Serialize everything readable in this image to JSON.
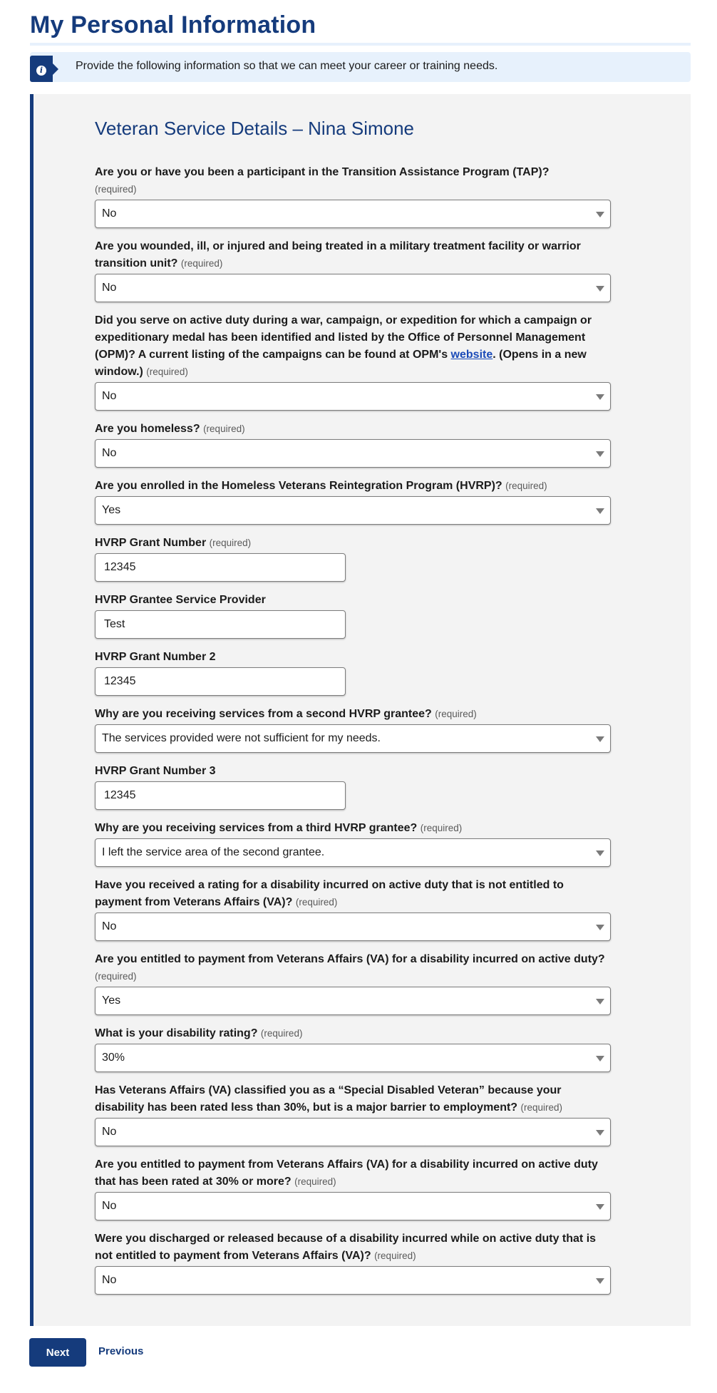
{
  "page": {
    "title": "My Personal Information",
    "info_banner": "Provide the following information so that we can meet your career or training needs.",
    "info_icon": "info-icon"
  },
  "panel": {
    "section_title": "Veteran Service Details – Nina Simone",
    "required_text": "(required)",
    "fields": [
      {
        "type": "select",
        "label": "Are you or have you been a participant in the Transition Assistance Program (TAP)?",
        "required": true,
        "value": "No"
      },
      {
        "type": "select",
        "label": "Are you wounded, ill, or injured and being treated in a military treatment facility or warrior transition unit?",
        "required": true,
        "value": "No"
      },
      {
        "type": "select",
        "label_before_link": "Did you serve on active duty during a war, campaign, or expedition for which a campaign or expeditionary medal has been identified and listed by the Office of Personnel Management (OPM)? A current listing of the campaigns can be found at OPM's ",
        "link_text": "website",
        "label_after_link": ". (Opens in a new window.)",
        "required": true,
        "value": "No"
      },
      {
        "type": "select",
        "label": "Are you homeless?",
        "required": true,
        "value": "No"
      },
      {
        "type": "select",
        "label": "Are you enrolled in the Homeless Veterans Reintegration Program (HVRP)?",
        "required": true,
        "value": "Yes"
      },
      {
        "type": "input",
        "label": "HVRP Grant Number",
        "required": true,
        "value": "12345"
      },
      {
        "type": "input",
        "label": "HVRP Grantee Service Provider",
        "required": false,
        "value": "Test"
      },
      {
        "type": "input",
        "label": "HVRP Grant Number 2",
        "required": false,
        "value": "12345"
      },
      {
        "type": "select",
        "label": "Why are you receiving services from a second HVRP grantee?",
        "required": true,
        "value": "The services provided were not sufficient for my needs."
      },
      {
        "type": "input",
        "label": "HVRP Grant Number 3",
        "required": false,
        "value": "12345"
      },
      {
        "type": "select",
        "label": "Why are you receiving services from a third HVRP grantee?",
        "required": true,
        "value": "I left the service area of the second grantee."
      },
      {
        "type": "select",
        "label": "Have you received a rating for a disability incurred on active duty that is not entitled to payment from Veterans Affairs (VA)?",
        "required": true,
        "value": "No"
      },
      {
        "type": "select",
        "label": "Are you entitled to payment from Veterans Affairs (VA) for a disability incurred on active duty?",
        "required": true,
        "value": "Yes"
      },
      {
        "type": "select",
        "label": "What is your disability rating?",
        "required": true,
        "value": "30%"
      },
      {
        "type": "select",
        "label": "Has Veterans Affairs (VA) classified you as a “Special Disabled Veteran” because your disability has been rated less than 30%, but is a major barrier to employment?",
        "required": true,
        "value": "No"
      },
      {
        "type": "select",
        "label": "Are you entitled to payment from Veterans Affairs (VA) for a disability incurred on active duty that has been rated at 30% or more?",
        "required": true,
        "value": "No"
      },
      {
        "type": "select",
        "label": "Were you discharged or released because of a disability incurred while on active duty that is not entitled to payment from Veterans Affairs (VA)?",
        "required": true,
        "value": "No"
      }
    ]
  },
  "actions": {
    "next_label": "Next",
    "previous_label": "Previous"
  }
}
